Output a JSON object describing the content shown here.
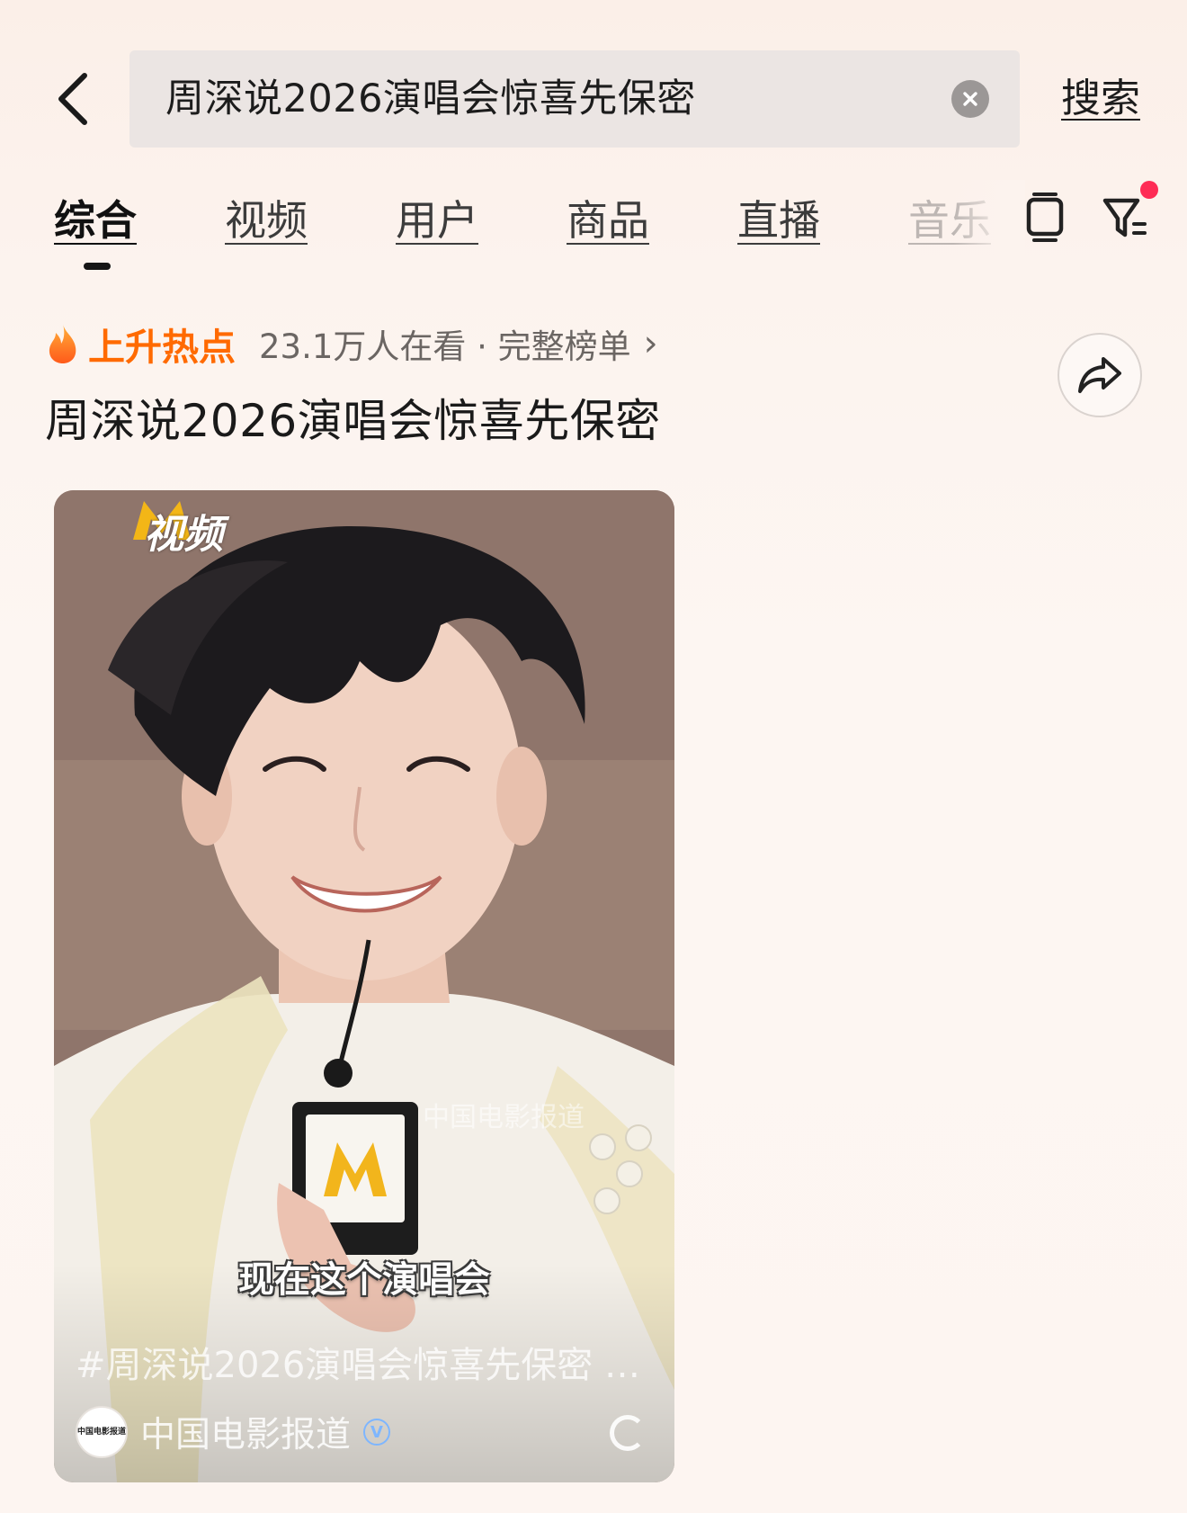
{
  "search": {
    "query": "周深说2026演唱会惊喜先保密",
    "submit_label": "搜索"
  },
  "tabs": [
    {
      "label": "综合",
      "active": true
    },
    {
      "label": "视频",
      "active": false
    },
    {
      "label": "用户",
      "active": false
    },
    {
      "label": "商品",
      "active": false
    },
    {
      "label": "直播",
      "active": false
    },
    {
      "label": "音乐",
      "active": false
    }
  ],
  "hot_topic": {
    "badge": "上升热点",
    "meta": "23.1万人在看 · 完整榜单",
    "title": "周深说2026演唱会惊喜先保密"
  },
  "video": {
    "watermark_brand": "视频",
    "watermark_source": "中国电影报道",
    "subtitle": "现在这个演唱会",
    "hashtag": "#周深说2026演唱会惊喜先保密 #...",
    "author_avatar_text": "中国电影报道",
    "author": "中国电影报道"
  },
  "colors": {
    "accent_hot": "#ff6a00",
    "notify_dot": "#fe2c55"
  },
  "icons": [
    "back-arrow-icon",
    "clear-icon",
    "tablet-icon",
    "filter-icon",
    "flame-icon",
    "chevron-right-icon",
    "share-icon",
    "verified-icon",
    "loading-icon"
  ]
}
